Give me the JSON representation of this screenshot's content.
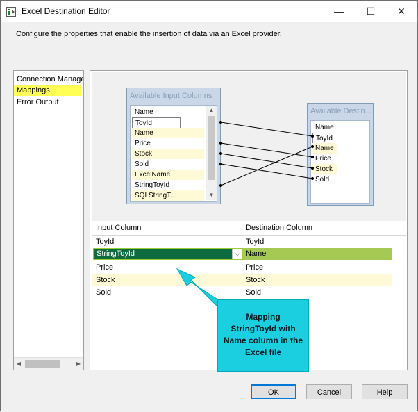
{
  "window": {
    "title": "Excel Destination Editor",
    "minimize_glyph": "—",
    "maximize_glyph": "☐",
    "close_glyph": "✕",
    "icon": "excel-destination-icon"
  },
  "description": "Configure the properties that enable the insertion of data via an Excel provider.",
  "nav": {
    "items": [
      {
        "label": "Connection Manager",
        "selected": false
      },
      {
        "label": "Mappings",
        "selected": true
      },
      {
        "label": "Error Output",
        "selected": false
      }
    ],
    "selected_color": "#ffff55"
  },
  "input_columns": {
    "title": "Available Input Columns",
    "header": "Name",
    "rows": [
      "ToyId",
      "Name",
      "Price",
      "Stock",
      "Sold",
      "ExcelName",
      "StringToyId",
      "SQLStringT..."
    ]
  },
  "dest_columns": {
    "title": "Available Destin...",
    "header": "Name",
    "rows": [
      "ToyId",
      "Name",
      "Price",
      "Stock",
      "Sold"
    ]
  },
  "mapping_grid": {
    "headers": [
      "Input Column",
      "Destination Column"
    ],
    "rows": [
      {
        "input": "ToyId",
        "destination": "ToyId",
        "selected": false
      },
      {
        "input": "StringToyId",
        "destination": "Name",
        "selected": true
      },
      {
        "input": "Price",
        "destination": "Price",
        "selected": false
      },
      {
        "input": "Stock",
        "destination": "Stock",
        "selected": false
      },
      {
        "input": "Sold",
        "destination": "Sold",
        "selected": false
      }
    ],
    "dropdown_glyph": "⌵"
  },
  "callout": {
    "lines": [
      "Mapping",
      "StringToyId with",
      "Name column in the",
      "Excel file"
    ],
    "color": "#1ccfe0"
  },
  "buttons": {
    "ok": "OK",
    "cancel": "Cancel",
    "help": "Help"
  }
}
